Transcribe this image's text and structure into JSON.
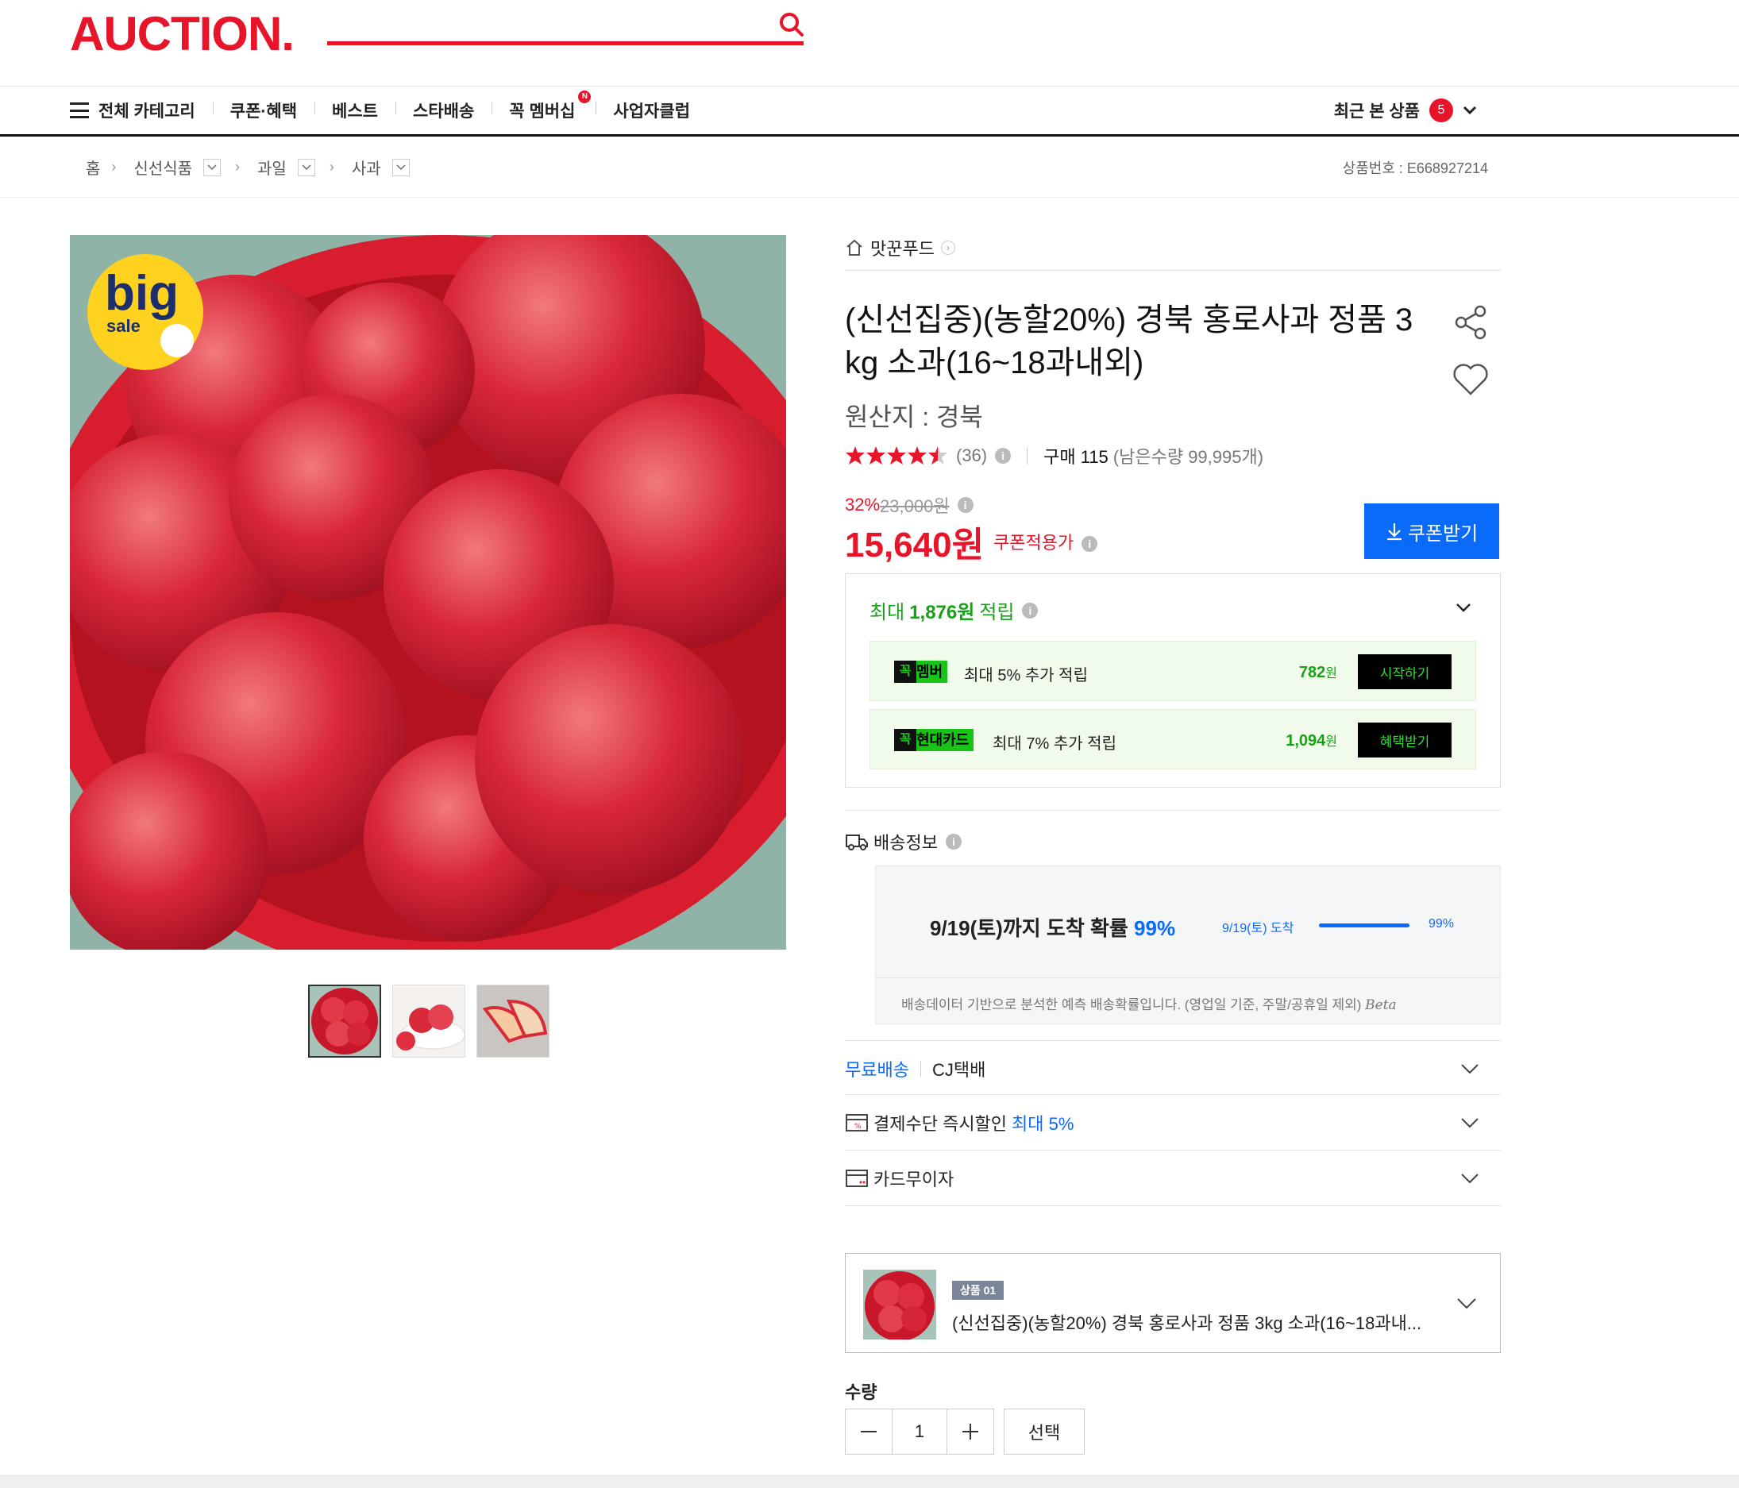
{
  "header": {
    "logo": "AUCTION.",
    "nav": [
      "전체 카테고리",
      "쿠폰·혜택",
      "베스트",
      "스타배송",
      "꼭 멤버십",
      "사업자클럽"
    ],
    "recent_label": "최근 본 상품",
    "recent_count": "5"
  },
  "breadcrumb": {
    "home": "홈",
    "items": [
      "신선식품",
      "과일",
      "사과"
    ],
    "product_no": "상품번호 : E668927214"
  },
  "image": {
    "badge_big": "big",
    "badge_sale": "sale"
  },
  "product": {
    "seller": "맛꾼푸드",
    "title": "(신선집중)(농할20%) 경북 홍로사과 정품 3 kg 소과(16~18과내외)",
    "origin": "원산지 : 경북",
    "rating": 4.5,
    "review_count": "(36)",
    "purchase_label": "구매 115",
    "stock_label": "(남은수량 99,995개)",
    "discount_rate": "32%",
    "original_price": "23,000원",
    "price": "15,640원",
    "price_note": "쿠폰적용가",
    "coupon_button": "쿠폰받기"
  },
  "points": {
    "prefix": "최대",
    "amount": "1,876원",
    "suffix": "적립",
    "perks": [
      {
        "k": "꼭",
        "tag": "멤버",
        "text": "최대 5% 추가 적립",
        "amount": "782",
        "unit": "원",
        "button": "시작하기"
      },
      {
        "k": "꼭",
        "tag": "현대카드",
        "text": "최대 7% 추가 적립",
        "amount": "1,094",
        "unit": "원",
        "button": "혜택받기"
      }
    ]
  },
  "shipping": {
    "heading": "배송정보",
    "main_prefix": "9/19(토)까지 도착 확률",
    "main_pct": "99%",
    "mini_label": "9/19(토) 도착",
    "mini_pct": "99%",
    "mini_fraction": 0.99,
    "note": "배송데이터 기반으로 분석한 예측 배송확률입니다. (영업일 기준, 주말/공휴일 제외)",
    "beta": "Beta",
    "free_label": "무료배송",
    "carrier": "CJ택배"
  },
  "payment": {
    "instant_label": "결제수단 즉시할인",
    "instant_highlight": "최대 5%",
    "card_label": "카드무이자"
  },
  "option": {
    "tag": "상품 01",
    "name": "(신선집중)(농할20%) 경북 홍로사과 정품 3kg 소과(16~18과내..."
  },
  "quantity": {
    "label": "수량",
    "value": "1",
    "select_button": "선택"
  },
  "colors": {
    "brand_red": "#e8142a",
    "accent_blue": "#0a6bfa",
    "point_green": "#19a019"
  }
}
